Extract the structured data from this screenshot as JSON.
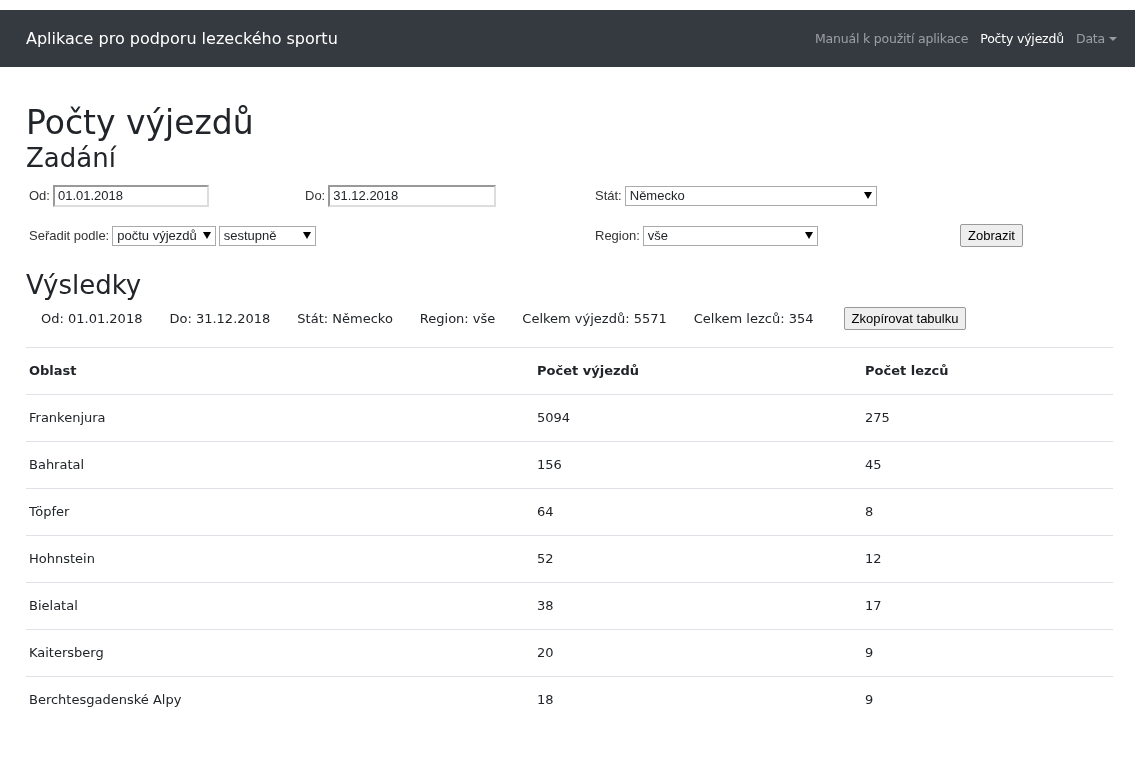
{
  "navbar": {
    "brand": "Aplikace pro podporu lezeckého sportu",
    "links": [
      {
        "label": "Manuál k použití aplikace",
        "selected": false,
        "kind": "link"
      },
      {
        "label": "Počty výjezdů",
        "selected": true,
        "kind": "link"
      },
      {
        "label": "Data",
        "selected": false,
        "kind": "dropdown"
      }
    ]
  },
  "page_title": "Počty výjezdů",
  "input_section": {
    "title": "Zadání",
    "from": {
      "label": "Od:",
      "value": "01.01.2018"
    },
    "to": {
      "label": "Do:",
      "value": "31.12.2018"
    },
    "country": {
      "label": "Stát:",
      "value": "Německo"
    },
    "sort": {
      "label": "Seřadit podle:",
      "value": "počtu výjezdů",
      "order": "sestupně"
    },
    "region": {
      "label": "Region:",
      "value": "vše"
    },
    "submit": "Zobrazit"
  },
  "results": {
    "title": "Výsledky",
    "summary": [
      "Od: 01.01.2018",
      "Do: 31.12.2018",
      "Stát: Německo",
      "Region: vše",
      "Celkem výjezdů: 5571",
      "Celkem lezců: 354"
    ],
    "copy_button": "Zkopírovat tabulku",
    "table": {
      "columns": [
        "Oblast",
        "Počet výjezdů",
        "Počet lezců"
      ],
      "rows": [
        [
          "Frankenjura",
          "5094",
          "275"
        ],
        [
          "Bahratal",
          "156",
          "45"
        ],
        [
          "Töpfer",
          "64",
          "8"
        ],
        [
          "Hohnstein",
          "52",
          "12"
        ],
        [
          "Bielatal",
          "38",
          "17"
        ],
        [
          "Kaitersberg",
          "20",
          "9"
        ],
        [
          "Berchtesgadenské Alpy",
          "18",
          "9"
        ]
      ]
    }
  }
}
